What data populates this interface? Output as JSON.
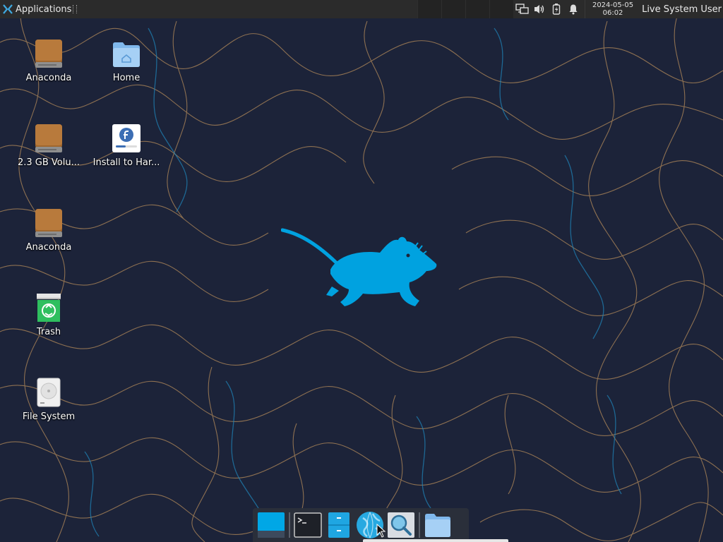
{
  "top_panel": {
    "apps_label": "Applications",
    "clock_date": "2024-05-05",
    "clock_time": "06:02",
    "user_label": "Live System User",
    "tray_icons": [
      "network-icon",
      "volume-icon",
      "battery-icon",
      "notification-bell-icon"
    ]
  },
  "desktop": {
    "icons": [
      {
        "name": "anaconda-drive-icon",
        "label": "Anaconda",
        "type": "drive"
      },
      {
        "name": "volume-drive-icon",
        "label": "2.3 GB Volu...",
        "type": "drive"
      },
      {
        "name": "anaconda-drive-2-icon",
        "label": "Anaconda",
        "type": "drive"
      },
      {
        "name": "trash-icon",
        "label": "Trash",
        "type": "trash"
      },
      {
        "name": "file-system-icon",
        "label": "File System",
        "type": "filesystem"
      },
      {
        "name": "home-folder-icon",
        "label": "Home",
        "type": "home"
      },
      {
        "name": "install-to-hard-drive-icon",
        "label": "Install to Har...",
        "type": "installer"
      }
    ]
  },
  "dock": {
    "items": [
      "show-desktop-icon",
      "terminal-icon",
      "file-manager-icon",
      "web-browser-icon",
      "app-finder-icon",
      "folder-icon"
    ]
  },
  "colors": {
    "panel_bg": "#2b2b2b",
    "wallpaper_bg": "#1c2339",
    "mouse_blue": "#00a2e0",
    "line_orange": "#c9945a",
    "line_blue": "#1f7fb0"
  }
}
